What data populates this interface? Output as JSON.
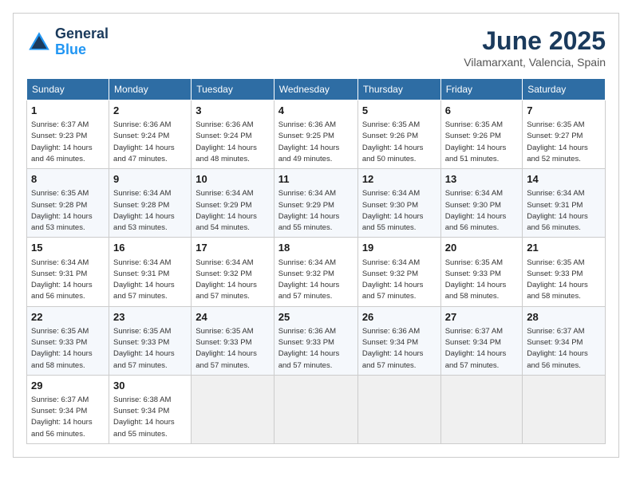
{
  "logo": {
    "line1": "General",
    "line2": "Blue"
  },
  "title": {
    "month": "June 2025",
    "location": "Vilamarxant, Valencia, Spain"
  },
  "weekdays": [
    "Sunday",
    "Monday",
    "Tuesday",
    "Wednesday",
    "Thursday",
    "Friday",
    "Saturday"
  ],
  "weeks": [
    [
      {
        "day": "1",
        "sunrise": "6:37 AM",
        "sunset": "9:23 PM",
        "daylight": "14 hours and 46 minutes."
      },
      {
        "day": "2",
        "sunrise": "6:36 AM",
        "sunset": "9:24 PM",
        "daylight": "14 hours and 47 minutes."
      },
      {
        "day": "3",
        "sunrise": "6:36 AM",
        "sunset": "9:24 PM",
        "daylight": "14 hours and 48 minutes."
      },
      {
        "day": "4",
        "sunrise": "6:36 AM",
        "sunset": "9:25 PM",
        "daylight": "14 hours and 49 minutes."
      },
      {
        "day": "5",
        "sunrise": "6:35 AM",
        "sunset": "9:26 PM",
        "daylight": "14 hours and 50 minutes."
      },
      {
        "day": "6",
        "sunrise": "6:35 AM",
        "sunset": "9:26 PM",
        "daylight": "14 hours and 51 minutes."
      },
      {
        "day": "7",
        "sunrise": "6:35 AM",
        "sunset": "9:27 PM",
        "daylight": "14 hours and 52 minutes."
      }
    ],
    [
      {
        "day": "8",
        "sunrise": "6:35 AM",
        "sunset": "9:28 PM",
        "daylight": "14 hours and 53 minutes."
      },
      {
        "day": "9",
        "sunrise": "6:34 AM",
        "sunset": "9:28 PM",
        "daylight": "14 hours and 53 minutes."
      },
      {
        "day": "10",
        "sunrise": "6:34 AM",
        "sunset": "9:29 PM",
        "daylight": "14 hours and 54 minutes."
      },
      {
        "day": "11",
        "sunrise": "6:34 AM",
        "sunset": "9:29 PM",
        "daylight": "14 hours and 55 minutes."
      },
      {
        "day": "12",
        "sunrise": "6:34 AM",
        "sunset": "9:30 PM",
        "daylight": "14 hours and 55 minutes."
      },
      {
        "day": "13",
        "sunrise": "6:34 AM",
        "sunset": "9:30 PM",
        "daylight": "14 hours and 56 minutes."
      },
      {
        "day": "14",
        "sunrise": "6:34 AM",
        "sunset": "9:31 PM",
        "daylight": "14 hours and 56 minutes."
      }
    ],
    [
      {
        "day": "15",
        "sunrise": "6:34 AM",
        "sunset": "9:31 PM",
        "daylight": "14 hours and 56 minutes."
      },
      {
        "day": "16",
        "sunrise": "6:34 AM",
        "sunset": "9:31 PM",
        "daylight": "14 hours and 57 minutes."
      },
      {
        "day": "17",
        "sunrise": "6:34 AM",
        "sunset": "9:32 PM",
        "daylight": "14 hours and 57 minutes."
      },
      {
        "day": "18",
        "sunrise": "6:34 AM",
        "sunset": "9:32 PM",
        "daylight": "14 hours and 57 minutes."
      },
      {
        "day": "19",
        "sunrise": "6:34 AM",
        "sunset": "9:32 PM",
        "daylight": "14 hours and 57 minutes."
      },
      {
        "day": "20",
        "sunrise": "6:35 AM",
        "sunset": "9:33 PM",
        "daylight": "14 hours and 58 minutes."
      },
      {
        "day": "21",
        "sunrise": "6:35 AM",
        "sunset": "9:33 PM",
        "daylight": "14 hours and 58 minutes."
      }
    ],
    [
      {
        "day": "22",
        "sunrise": "6:35 AM",
        "sunset": "9:33 PM",
        "daylight": "14 hours and 58 minutes."
      },
      {
        "day": "23",
        "sunrise": "6:35 AM",
        "sunset": "9:33 PM",
        "daylight": "14 hours and 57 minutes."
      },
      {
        "day": "24",
        "sunrise": "6:35 AM",
        "sunset": "9:33 PM",
        "daylight": "14 hours and 57 minutes."
      },
      {
        "day": "25",
        "sunrise": "6:36 AM",
        "sunset": "9:33 PM",
        "daylight": "14 hours and 57 minutes."
      },
      {
        "day": "26",
        "sunrise": "6:36 AM",
        "sunset": "9:34 PM",
        "daylight": "14 hours and 57 minutes."
      },
      {
        "day": "27",
        "sunrise": "6:37 AM",
        "sunset": "9:34 PM",
        "daylight": "14 hours and 57 minutes."
      },
      {
        "day": "28",
        "sunrise": "6:37 AM",
        "sunset": "9:34 PM",
        "daylight": "14 hours and 56 minutes."
      }
    ],
    [
      {
        "day": "29",
        "sunrise": "6:37 AM",
        "sunset": "9:34 PM",
        "daylight": "14 hours and 56 minutes."
      },
      {
        "day": "30",
        "sunrise": "6:38 AM",
        "sunset": "9:34 PM",
        "daylight": "14 hours and 55 minutes."
      },
      null,
      null,
      null,
      null,
      null
    ]
  ]
}
